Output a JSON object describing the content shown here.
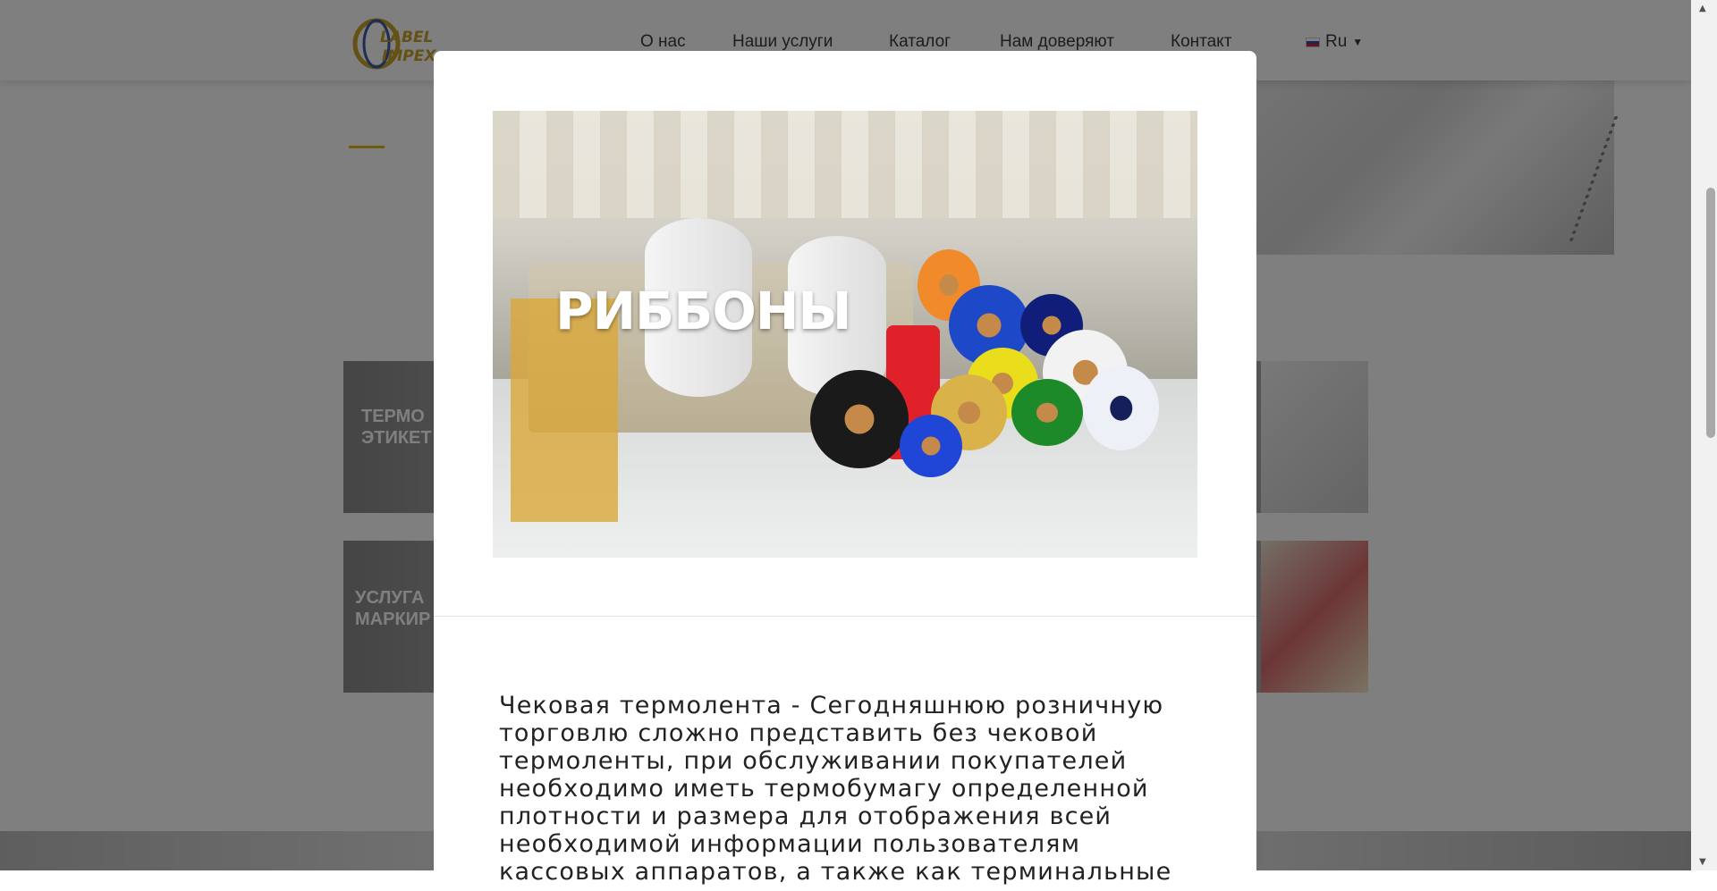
{
  "header": {
    "logo_text": "LABEL IMPEX",
    "nav": [
      "О нас",
      "Наши услуги",
      "Каталог",
      "Нам доверяют",
      "Контакт"
    ],
    "language": "Ru"
  },
  "cards": [
    {
      "title": "ТЕРМО\nЭТИКЕТ"
    },
    {
      "title": "УСЛУГА\nМАРКИР"
    }
  ],
  "modal": {
    "image_title": "РИББОНЫ",
    "description": "Чековая термолента - Сегодняшнюю розничную торговлю сложно представить без чековой термоленты, при обслуживании покупателей необходимо иметь термобумагу определенной плотности и размера для отображения всей необходимой информации пользователям кассовых аппаратов, а также как терминальные"
  },
  "colors": {
    "accent": "#e3b21c",
    "overlay": "rgba(0,0,0,0.5)"
  }
}
